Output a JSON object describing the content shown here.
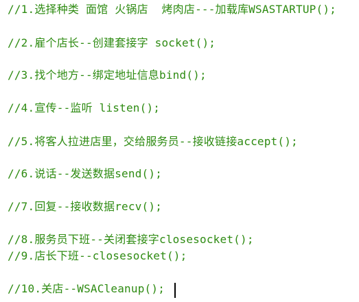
{
  "editor": {
    "colors": {
      "comment": "#2e8b12",
      "background": "#ffffff",
      "caret": "#000000"
    },
    "lines": [
      "//1.选择种类 面馆 火锅店  烤肉店---加载库WSASTARTUP();",
      "//2.雇个店长--创建套接字 socket();",
      "//3.找个地方--绑定地址信息bind();",
      "//4.宣传--监听 listen();",
      "//5.将客人拉进店里，交给服务员--接收链接accept();",
      "//6.说话--发送数据send();",
      "//7.回复--接收数据recv();",
      "//8.服务员下班--关闭套接字closesocket();",
      "//9.店长下班--closesocket();",
      "//10.关店--WSACleanup();"
    ]
  }
}
